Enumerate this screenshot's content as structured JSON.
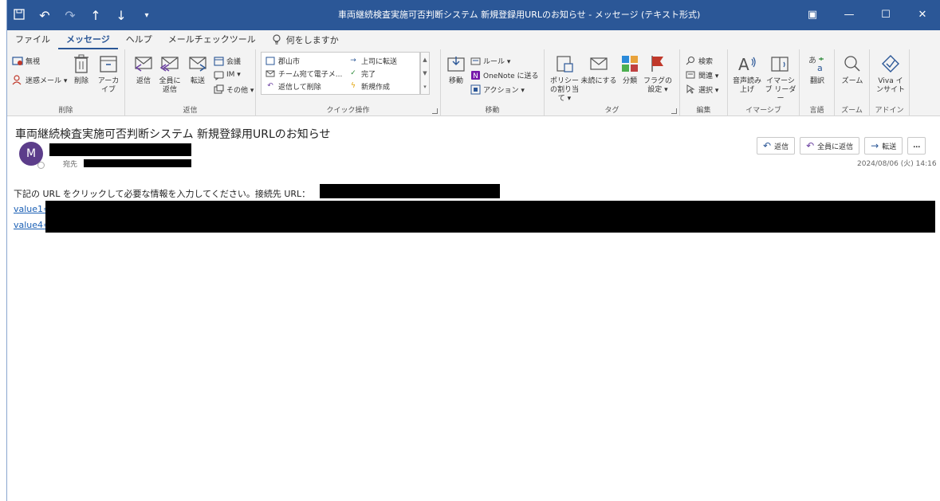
{
  "titlebar": {
    "title": "車両継続検査実施可否判断システム 新規登録用URLのお知らせ - メッセージ (テキスト形式)",
    "qat_icons": [
      "save-icon",
      "undo-icon",
      "redo-icon",
      "up-arrow-icon",
      "down-arrow-icon",
      "customize-icon"
    ],
    "controls": {
      "ribbon_display": "▣",
      "minimize": "—",
      "maximize": "☐",
      "close": "✕"
    }
  },
  "menu": {
    "tabs": [
      "ファイル",
      "メッセージ",
      "ヘルプ",
      "メールチェックツール"
    ],
    "active_tab": "メッセージ",
    "tell_me": "何をしますか"
  },
  "ribbon": {
    "delete_group": {
      "label": "削除",
      "ignore": "無視",
      "junk": "迷惑メール ▾",
      "delete": "削除",
      "archive": "アーカイブ"
    },
    "respond_group": {
      "label": "返信",
      "reply": "返信",
      "reply_all": "全員に返信",
      "forward": "転送",
      "meeting": "会議",
      "im": "IM ▾",
      "more": "その他 ▾"
    },
    "quick_steps_group": {
      "label": "クイック操作",
      "items": [
        "郡山市",
        "チーム宛て電子メ...",
        "返信して削除",
        "上司に転送",
        "完了",
        "新規作成"
      ]
    },
    "move_group": {
      "label": "移動",
      "move": "移動",
      "rules": "ルール ▾",
      "onenote": "OneNote に送る",
      "actions": "アクション ▾"
    },
    "tags_group": {
      "label": "タグ",
      "policy": "ポリシーの割り当て ▾",
      "unread": "未読にする",
      "categorize": "分類",
      "follow_up": "フラグの設定 ▾"
    },
    "editing_group": {
      "label": "編集",
      "find": "検索",
      "related": "関連 ▾",
      "select": "選択 ▾"
    },
    "immersive_group": {
      "label": "イマーシブ",
      "read_aloud": "音声読み上げ",
      "immersive_reader": "イマーシブ リーダー"
    },
    "language_group": {
      "label": "言語",
      "translate": "翻訳"
    },
    "zoom_group": {
      "label": "ズーム",
      "zoom": "ズーム"
    },
    "addin_group": {
      "label": "アドイン",
      "viva": "Viva インサイト"
    }
  },
  "message": {
    "subject": "車両継続検査実施可否判断システム 新規登録用URLのお知らせ",
    "avatar_initial": "M",
    "to_label": "宛先",
    "actions": {
      "reply": "返信",
      "reply_all": "全員に返信",
      "forward": "転送",
      "more": "…"
    },
    "date": "2024/08/06 (火) 14:16",
    "body_line": "下記の URL をクリックして必要な情報を入力してください。接続先 URL：",
    "link1": "value1=",
    "link2": "value4="
  },
  "colors": {
    "titlebar": "#2b5797",
    "ribbon": "#f3f3f3",
    "link": "#1a5fb4",
    "avatar": "#5c3d8a",
    "flag": "#c0392b"
  }
}
